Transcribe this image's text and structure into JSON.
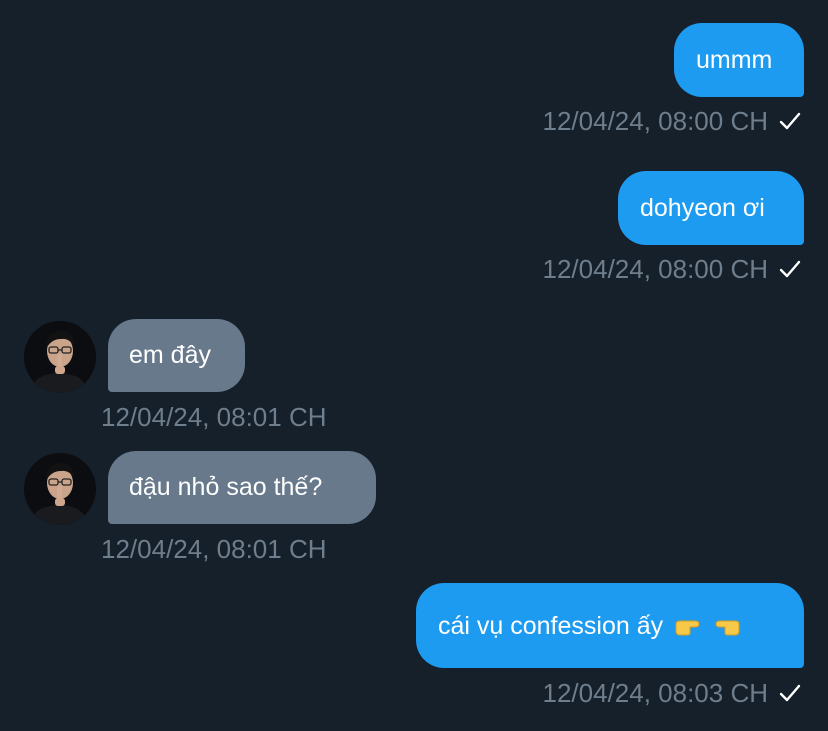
{
  "theme": {
    "background": "#15202b",
    "sent_bubble": "#1d9bf0",
    "received_bubble": "#67798a",
    "timestamp_color": "#6f7e8c"
  },
  "messages": [
    {
      "text": "ummm",
      "time": "12/04/24, 08:00 CH",
      "sender": "me",
      "status_icon": "check-icon"
    },
    {
      "text": "dohyeon ơi",
      "time": "12/04/24, 08:00 CH",
      "sender": "me",
      "status_icon": "check-icon"
    },
    {
      "text": "em đây",
      "time": "12/04/24, 08:01 CH",
      "sender": "other",
      "avatar": "avatar-icon"
    },
    {
      "text": "đậu nhỏ sao thế?",
      "time": "12/04/24, 08:01 CH",
      "sender": "other",
      "avatar": "avatar-icon"
    },
    {
      "text": "cái vụ confession ấy",
      "emoji": [
        "pointing-right-emoji",
        "pointing-left-emoji"
      ],
      "time": "12/04/24, 08:03 CH",
      "sender": "me",
      "status_icon": "check-icon"
    }
  ]
}
